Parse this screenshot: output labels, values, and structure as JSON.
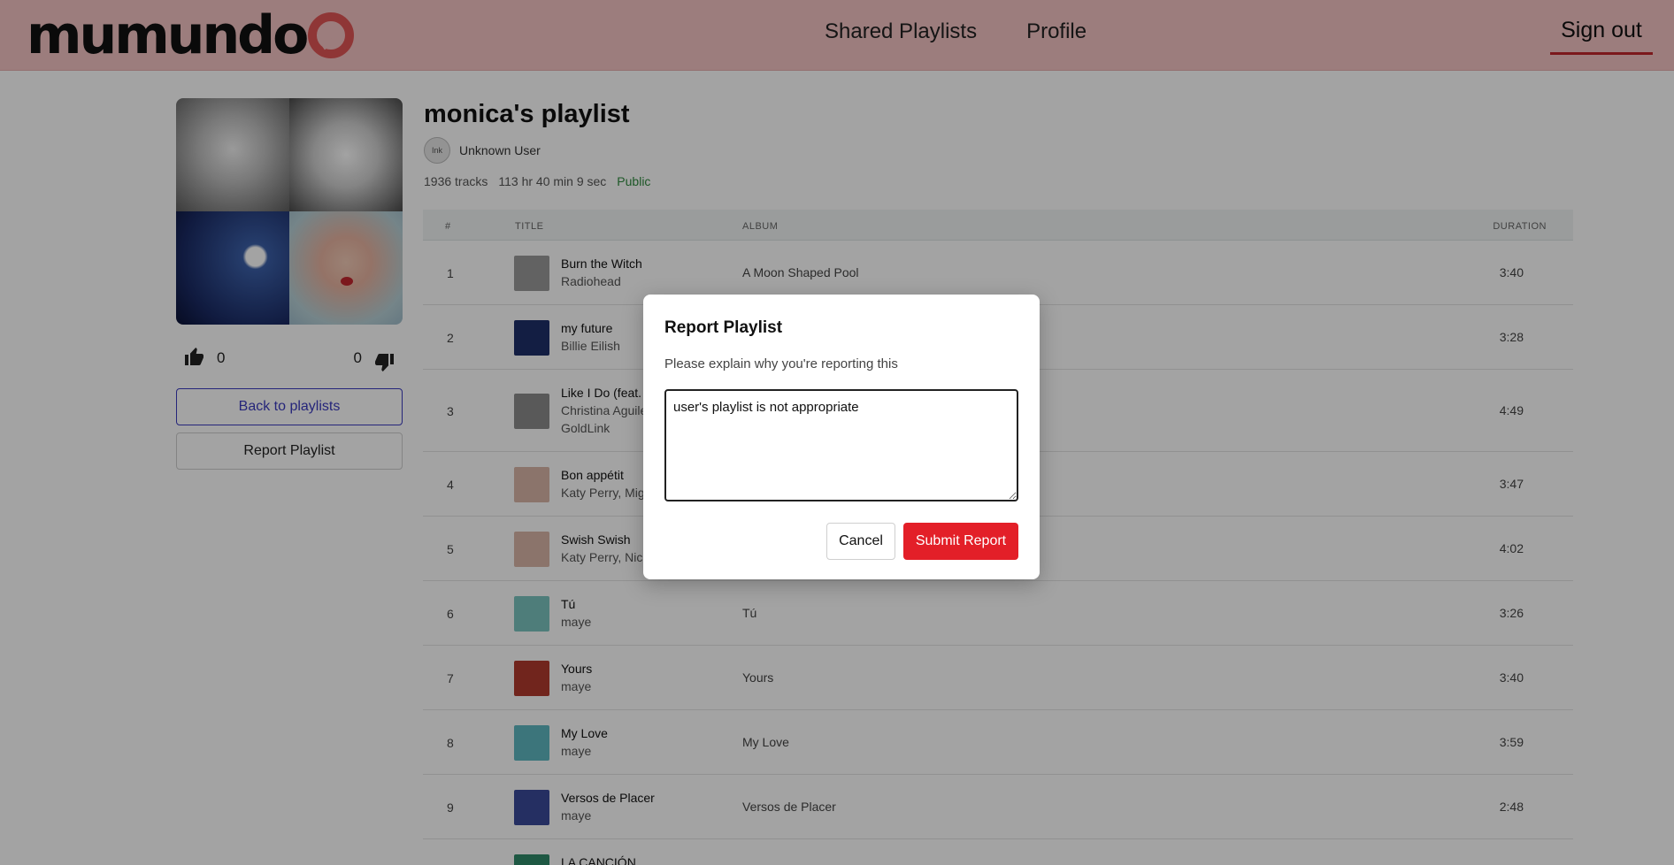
{
  "header": {
    "logo": "mumundo",
    "nav": [
      {
        "label": "Shared Playlists"
      },
      {
        "label": "Profile"
      }
    ],
    "signout_label": "Sign out"
  },
  "playlist": {
    "title": "monica's playlist",
    "owner": "Unknown User",
    "avatar_alt": "Ink",
    "tracks_count": "1936 tracks",
    "duration": "113 hr 40 min 9 sec",
    "visibility": "Public",
    "likes": "0",
    "dislikes": "0",
    "back_label": "Back to playlists",
    "report_label": "Report Playlist"
  },
  "table": {
    "headers": {
      "num": "#",
      "title": "TITLE",
      "album": "ALBUM",
      "duration": "DURATION"
    },
    "rows": [
      {
        "num": "1",
        "title": "Burn the Witch",
        "artist": "Radiohead",
        "artist2": "",
        "album": "A Moon Shaped Pool",
        "duration": "3:40",
        "color": "#9a9a9a"
      },
      {
        "num": "2",
        "title": "my future",
        "artist": "Billie Eilish",
        "artist2": "",
        "album": "",
        "duration": "3:28",
        "color": "#1f2f6a"
      },
      {
        "num": "3",
        "title": "Like I Do (feat. G",
        "artist": "Christina Aguile",
        "artist2": "GoldLink",
        "album": "",
        "duration": "4:49",
        "color": "#8c8c8c"
      },
      {
        "num": "4",
        "title": "Bon appétit",
        "artist": "Katy Perry, Migo",
        "artist2": "",
        "album": "",
        "duration": "3:47",
        "color": "#d9b6a8"
      },
      {
        "num": "5",
        "title": "Swish Swish",
        "artist": "Katy Perry, Nick",
        "artist2": "",
        "album": "",
        "duration": "4:02",
        "color": "#d9b6a8"
      },
      {
        "num": "6",
        "title": "Tú",
        "artist": "maye",
        "artist2": "",
        "album": "Tú",
        "duration": "3:26",
        "color": "#7bc4bf"
      },
      {
        "num": "7",
        "title": "Yours",
        "artist": "maye",
        "artist2": "",
        "album": "Yours",
        "duration": "3:40",
        "color": "#b13a2e"
      },
      {
        "num": "8",
        "title": "My Love",
        "artist": "maye",
        "artist2": "",
        "album": "My Love",
        "duration": "3:59",
        "color": "#5fb7c0"
      },
      {
        "num": "9",
        "title": "Versos de Placer",
        "artist": "maye",
        "artist2": "",
        "album": "Versos de Placer",
        "duration": "2:48",
        "color": "#3a4a9a"
      },
      {
        "num": "",
        "title": "LA CANCIÓN",
        "artist": "",
        "artist2": "",
        "album": "",
        "duration": "",
        "color": "#2f8a6a"
      }
    ]
  },
  "modal": {
    "title": "Report Playlist",
    "description": "Please explain why you're reporting this",
    "reason_value": "user's playlist is not appropriate",
    "cancel_label": "Cancel",
    "submit_label": "Submit Report"
  },
  "colors": {
    "header_bg": "#f5c4c4",
    "accent_red": "#e31f28",
    "link_blue": "#3b3bbf",
    "public_green": "#2f8a3f"
  }
}
